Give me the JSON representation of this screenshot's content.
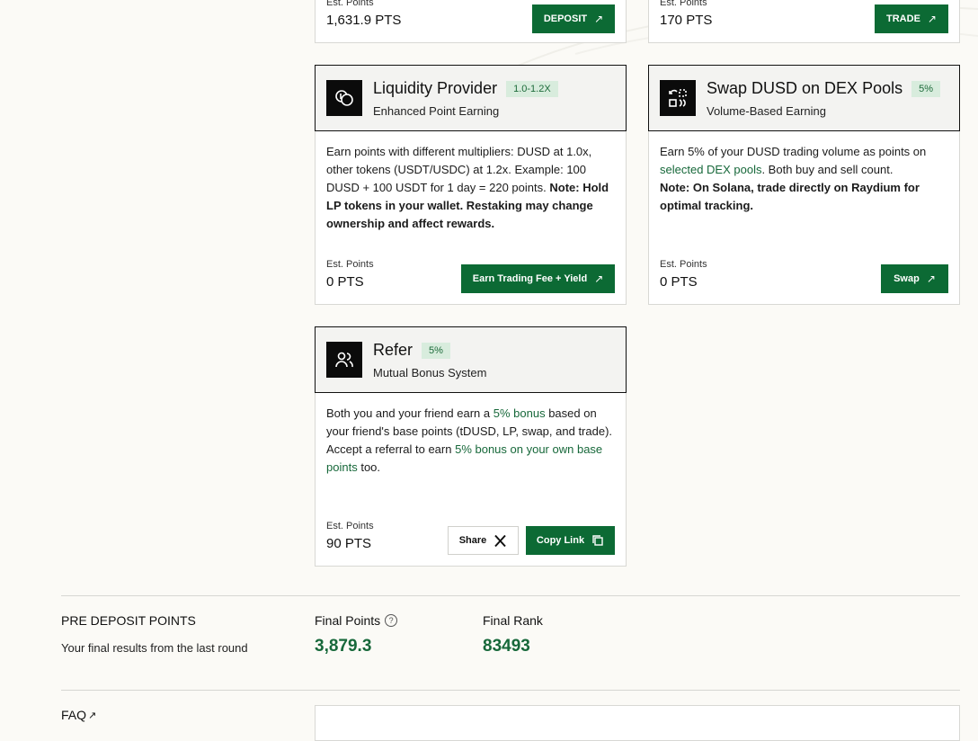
{
  "cards": {
    "top_left": {
      "est_label": "Est. Points",
      "est_value": "1,631.9 PTS",
      "button": "DEPOSIT",
      "button_icon": "arrow-up-right-icon"
    },
    "top_right": {
      "est_label": "Est. Points",
      "est_value": "170 PTS",
      "button": "TRADE",
      "button_icon": "arrow-up-right-icon"
    },
    "lp": {
      "title": "Liquidity Provider",
      "badge": "1.0-1.2X",
      "subtitle": "Enhanced Point Earning",
      "body_1": "Earn points with different multipliers: DUSD at 1.0x, other tokens (USDT/USDC) at 1.2x. Example: 100 DUSD + 100 USDT for 1 day = 220 points.",
      "body_note": "Note: Hold LP tokens in your wallet. Restaking may change ownership and affect rewards.",
      "est_label": "Est. Points",
      "est_value": "0 PTS",
      "button": "Earn Trading Fee + Yield",
      "icon": "coins-icon"
    },
    "swap": {
      "title": "Swap DUSD on DEX Pools",
      "badge": "5%",
      "subtitle": "Volume-Based Earning",
      "body_1": "Earn 5% of your DUSD trading volume as points on",
      "body_link": "selected DEX pools",
      "body_2": ". Both buy and sell count.",
      "body_note": "Note: On Solana, trade directly on Raydium for optimal tracking.",
      "est_label": "Est. Points",
      "est_value": "0 PTS",
      "button": "Swap",
      "icon": "swap-icon"
    },
    "refer": {
      "title": "Refer",
      "badge": "5%",
      "subtitle": "Mutual Bonus System",
      "body_1": "Both you and your friend earn a",
      "body_link_1": "5% bonus",
      "body_2": "based on your friend's base points (tDUSD, LP, swap, and trade).",
      "body_3": "Accept a referral to earn",
      "body_link_2": "5% bonus on your own base points",
      "body_4": "too.",
      "est_label": "Est. Points",
      "est_value": "90 PTS",
      "share_button": "Share",
      "copy_button": "Copy Link",
      "icon": "users-icon"
    }
  },
  "pre_deposit": {
    "heading": "PRE DEPOSIT POINTS",
    "subheading": "Your final results from the last round",
    "final_points_label": "Final Points",
    "final_points_value": "3,879.3",
    "final_rank_label": "Final Rank",
    "final_rank_value": "83493"
  },
  "faq": {
    "label": "FAQ"
  },
  "colors": {
    "accent": "#0c6a34",
    "badge_bg": "#d8ecdd",
    "background": "#fbfaf6"
  }
}
